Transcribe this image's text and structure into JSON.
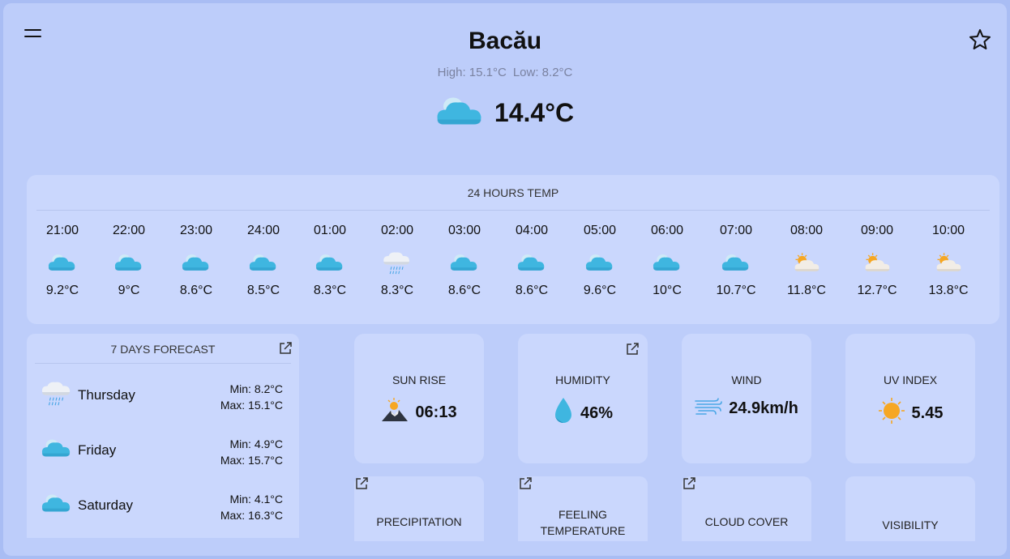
{
  "header": {
    "city": "Bacău",
    "high": "High: 15.1°C",
    "low": "Low: 8.2°C",
    "current_temp": "14.4°C",
    "current_icon": "cloudy-icon"
  },
  "hourly": {
    "title": "24 HOURS TEMP",
    "items": [
      {
        "time": "21:00",
        "temp": "9.2°C",
        "icon": "cloud"
      },
      {
        "time": "22:00",
        "temp": "9°C",
        "icon": "cloud"
      },
      {
        "time": "23:00",
        "temp": "8.6°C",
        "icon": "cloud"
      },
      {
        "time": "24:00",
        "temp": "8.5°C",
        "icon": "cloud"
      },
      {
        "time": "01:00",
        "temp": "8.3°C",
        "icon": "cloud"
      },
      {
        "time": "02:00",
        "temp": "8.3°C",
        "icon": "rain"
      },
      {
        "time": "03:00",
        "temp": "8.6°C",
        "icon": "cloud"
      },
      {
        "time": "04:00",
        "temp": "8.6°C",
        "icon": "cloud"
      },
      {
        "time": "05:00",
        "temp": "9.6°C",
        "icon": "cloud"
      },
      {
        "time": "06:00",
        "temp": "10°C",
        "icon": "cloud"
      },
      {
        "time": "07:00",
        "temp": "10.7°C",
        "icon": "cloud"
      },
      {
        "time": "08:00",
        "temp": "11.8°C",
        "icon": "partly-sunny"
      },
      {
        "time": "09:00",
        "temp": "12.7°C",
        "icon": "partly-sunny"
      },
      {
        "time": "10:00",
        "temp": "13.8°C",
        "icon": "partly-sunny"
      }
    ]
  },
  "forecast": {
    "title": "7 DAYS FORECAST",
    "days": [
      {
        "day": "Thursday",
        "min": "Min: 8.2°C",
        "max": "Max: 15.1°C",
        "icon": "rain"
      },
      {
        "day": "Friday",
        "min": "Min: 4.9°C",
        "max": "Max: 15.7°C",
        "icon": "cloud"
      },
      {
        "day": "Saturday",
        "min": "Min: 4.1°C",
        "max": "Max: 16.3°C",
        "icon": "cloud"
      }
    ]
  },
  "tiles": {
    "sunrise": {
      "label": "SUN RISE",
      "value": "06:13",
      "icon": "sunrise-icon"
    },
    "humidity": {
      "label": "HUMIDITY",
      "value": "46%",
      "icon": "droplet-icon"
    },
    "wind": {
      "label": "WIND",
      "value": "24.9km/h",
      "icon": "wind-icon"
    },
    "uv": {
      "label": "UV INDEX",
      "value": "5.45",
      "icon": "sun-icon"
    },
    "precipitation": {
      "label": "PRECIPITATION"
    },
    "feeling": {
      "label_line1": "FEELING",
      "label_line2": "TEMPERATURE"
    },
    "cloud_cover": {
      "label": "CLOUD COVER"
    },
    "visibility": {
      "label": "VISIBILITY"
    }
  },
  "colors": {
    "background": "#bdcdfa",
    "card": "#cad7fd",
    "cloud": "#3fb6e0",
    "sun": "#f6a723"
  }
}
